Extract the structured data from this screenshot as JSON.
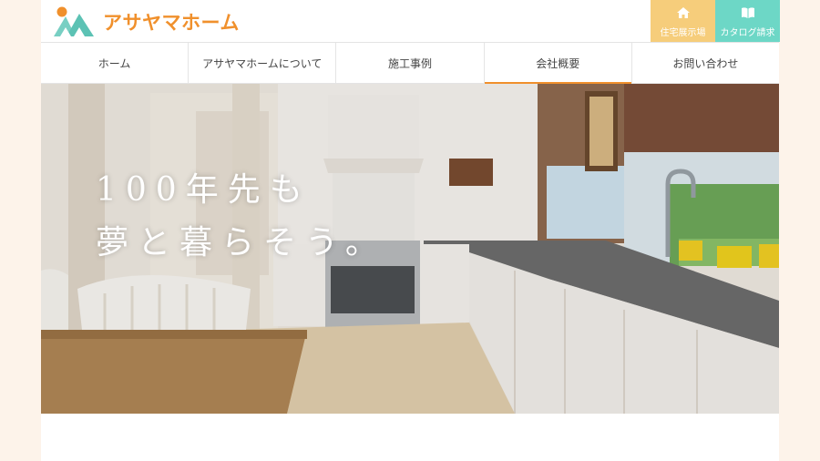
{
  "brand": {
    "name": "アサヤマホーム"
  },
  "utility": {
    "showroom": {
      "label": "住宅展示場",
      "icon": "home-icon",
      "color": "#f6cd7b"
    },
    "catalog": {
      "label": "カタログ請求",
      "icon": "book-icon",
      "color": "#6dd7c6"
    }
  },
  "nav": {
    "items": [
      {
        "label": "ホーム"
      },
      {
        "label": "アサヤマホームについて"
      },
      {
        "label": "施工事例"
      },
      {
        "label": "会社概要"
      },
      {
        "label": "お問い合わせ"
      }
    ]
  },
  "hero": {
    "line1": "100年先も",
    "line2": "夢と暮らそう。"
  },
  "colors": {
    "accent": "#f0902c",
    "page_bg": "#fdf3ea"
  }
}
